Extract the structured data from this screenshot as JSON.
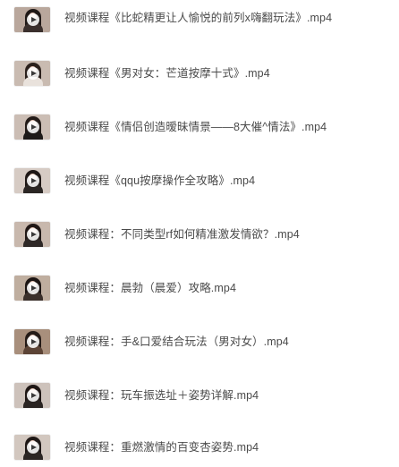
{
  "files": [
    {
      "name": "视频课程《比蛇精更让人愉悦的前列x嗨翻玩法》.mp4",
      "thumb": {
        "bg": "#b9a79c",
        "shirt": "#3a2f2c",
        "hair": "#1f1816"
      }
    },
    {
      "name": "视频课程《男对女：芒道按摩十式》.mp4",
      "thumb": {
        "bg": "#c9bbb1",
        "shirt": "#e9e2dc",
        "hair": "#2a201c"
      }
    },
    {
      "name": "视频课程《情侣创造暧昧情景——8大催^情法》.mp4",
      "thumb": {
        "bg": "#cbbdb4",
        "shirt": "#1e1a19",
        "hair": "#231b18"
      }
    },
    {
      "name": "视频课程《qqu按摩操作全攻略》.mp4",
      "thumb": {
        "bg": "#d6cbc4",
        "shirt": "#2b2624",
        "hair": "#1e1715"
      }
    },
    {
      "name": "视频课程：不同类型rf如何精准激发情欲？.mp4",
      "thumb": {
        "bg": "#c8b8ad",
        "shirt": "#2e2826",
        "hair": "#201816"
      }
    },
    {
      "name": "视频课程：晨勃（晨爱）攻略.mp4",
      "thumb": {
        "bg": "#bfae9f",
        "shirt": "#3b302b",
        "hair": "#1c1513"
      }
    },
    {
      "name": "视频课程：手&口爱结合玩法（男对女）.mp4",
      "thumb": {
        "bg": "#a88f7c",
        "shirt": "#5c4436",
        "hair": "#241a16"
      }
    },
    {
      "name": "视频课程：玩车振选址＋姿势详解.mp4",
      "thumb": {
        "bg": "#cdc2bb",
        "shirt": "#2a2422",
        "hair": "#1e1614"
      }
    },
    {
      "name": "视频课程：重燃激情的百变杏姿势.mp4",
      "thumb": {
        "bg": "#d2c7bf",
        "shirt": "#2c2624",
        "hair": "#1f1816"
      }
    }
  ]
}
